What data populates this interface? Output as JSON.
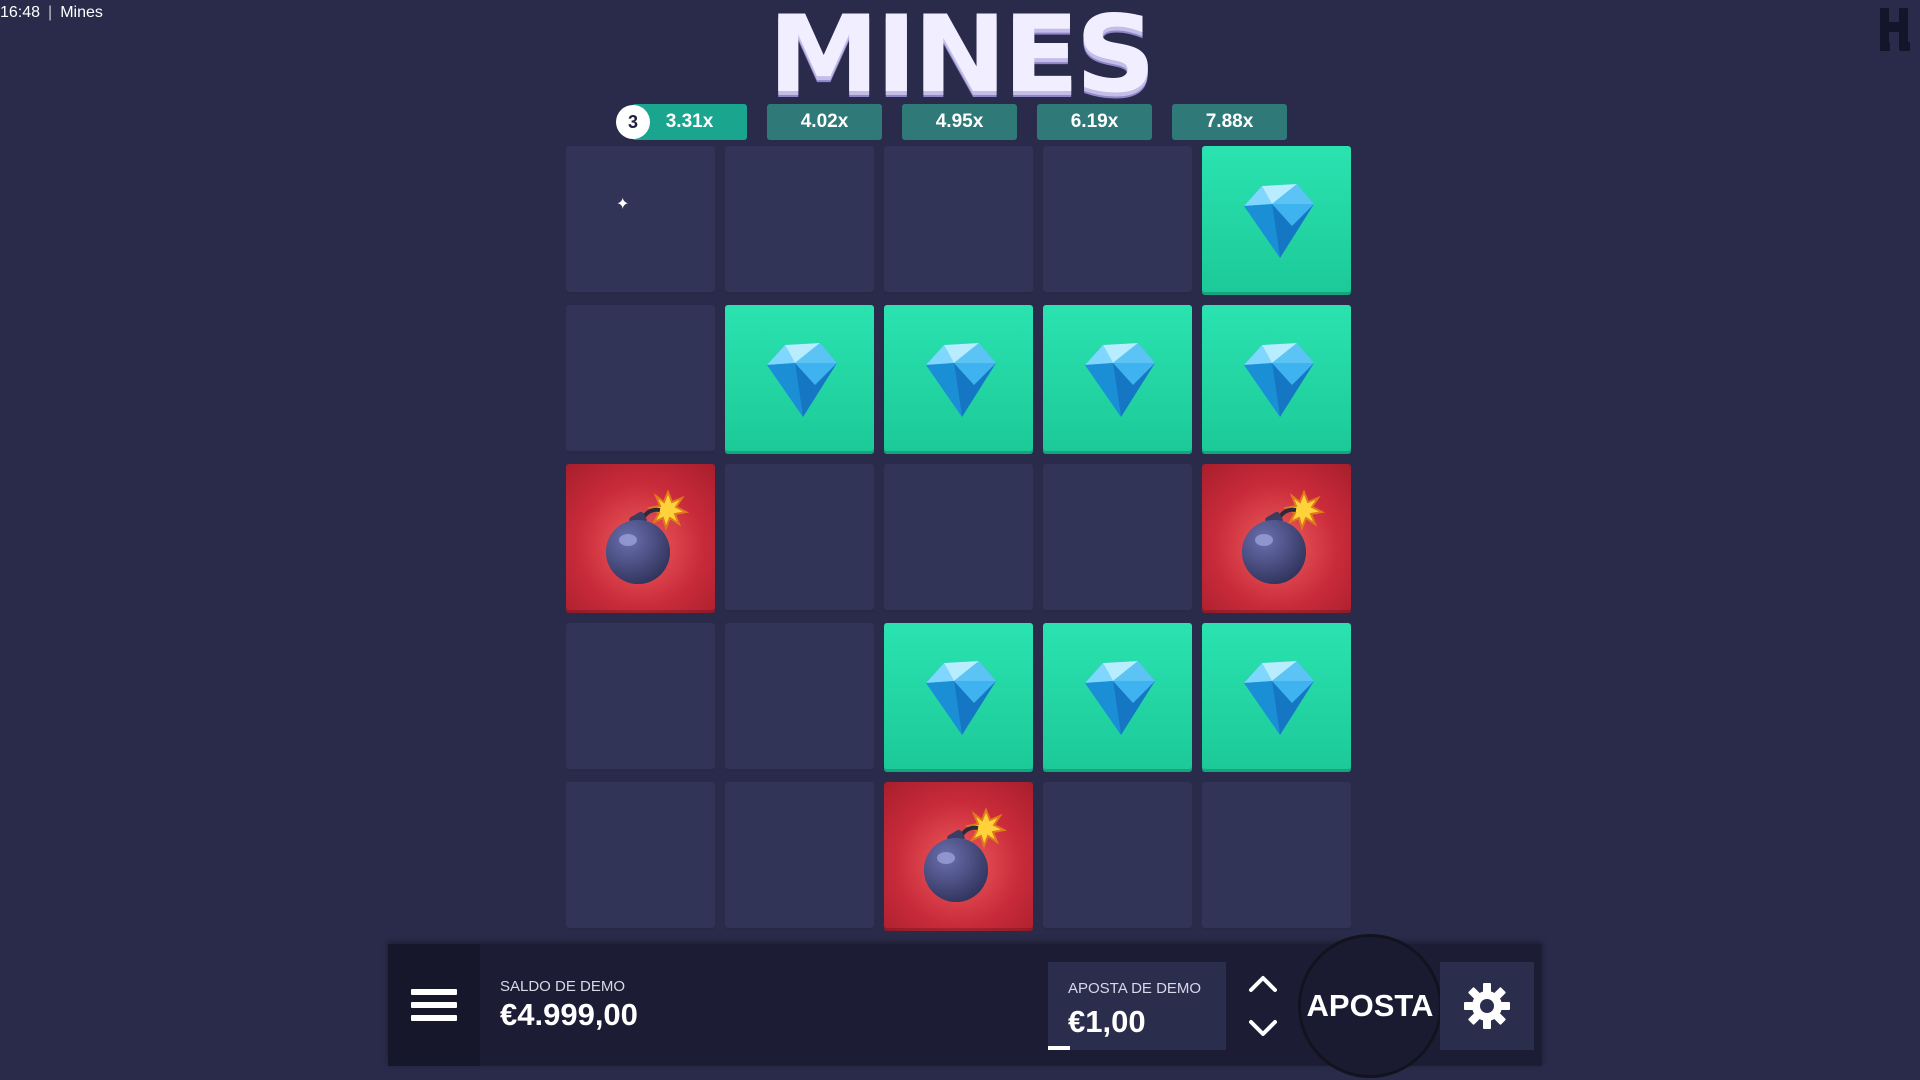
{
  "window": {
    "time": "16:48",
    "separator": "|",
    "title": "Mines"
  },
  "game": {
    "title": "MINES",
    "brand_icon": "brand-logo-icon"
  },
  "multipliers": {
    "counter": "3",
    "items": [
      "3.31x",
      "4.02x",
      "4.95x",
      "6.19x",
      "7.88x"
    ],
    "active_index": 0
  },
  "grid": {
    "rows": 5,
    "cols": 5,
    "tiles": [
      [
        "hidden",
        "hidden",
        "hidden",
        "hidden",
        "gem"
      ],
      [
        "hidden",
        "gem",
        "gem",
        "gem",
        "gem"
      ],
      [
        "bomb",
        "hidden",
        "hidden",
        "hidden",
        "bomb"
      ],
      [
        "hidden",
        "hidden",
        "gem",
        "gem",
        "gem"
      ],
      [
        "hidden",
        "hidden",
        "bomb",
        "hidden",
        "hidden"
      ]
    ]
  },
  "bottom_bar": {
    "menu_icon": "menu-icon",
    "balance_label": "SALDO DE DEMO",
    "balance_value": "€4.999,00",
    "bet_label": "APOSTA DE DEMO",
    "bet_value": "€1,00",
    "play_label": "APOSTA",
    "settings_icon": "gear-icon"
  },
  "colors": {
    "background": "#2a2b4a",
    "tile_hidden": "#313357",
    "tile_gem": "#22d6a4",
    "tile_bomb": "#c92b3a",
    "multiplier_active": "#1aa58f",
    "multiplier": "#2f7a78"
  }
}
